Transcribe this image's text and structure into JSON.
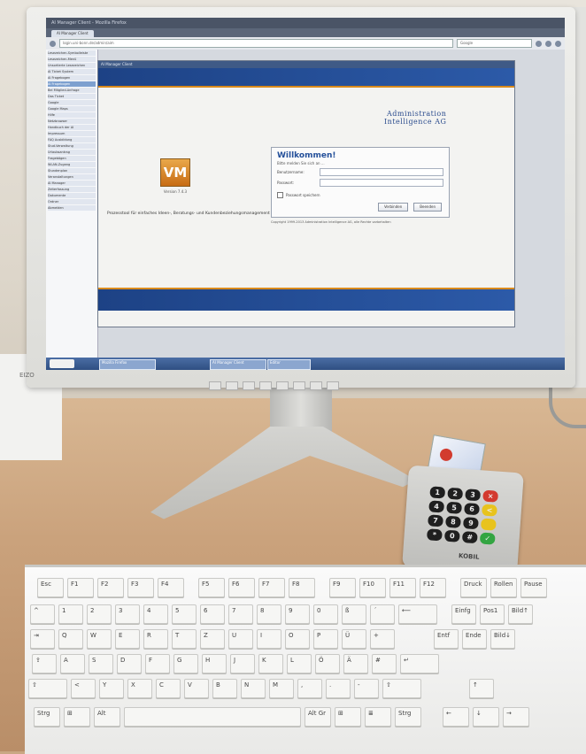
{
  "browser": {
    "window_title": "AI Manager Client - Mozilla Firefox",
    "tab_label": "AI Manager Client",
    "url": "login.uni-bonn.de/admin/aim",
    "search_placeholder": "Google"
  },
  "sidebar": {
    "items": [
      "Lesezeichen-Symbolleiste",
      "Lesezeichen-Menü",
      "Unsortierte Lesezeichen",
      "AI Ticket System",
      "AI Fragebogen",
      "AI Fragebogen",
      "Bei Mitglied-Anfrage",
      "Das Ticket",
      "Google",
      "Google Maps",
      "Hilfe",
      "Netzbrowser",
      "Handbuch der AI",
      "Impressum",
      "FAQ Ausbildung",
      "Stud-Verwaltung",
      "Urlaubsantrag",
      "Fragebögen",
      "WLAN-Zugang",
      "Stundenplan",
      "Veranstaltungen",
      "AI Manager",
      "Zeiterfassung",
      "Dokumente",
      "Ordner",
      "Abmelden"
    ],
    "selected_index": 5
  },
  "app_window": {
    "title": "AI Manager Client",
    "brand_line1": "Administration",
    "brand_line2": "Intelligence AG",
    "logo": "VM",
    "version": "Version 7.4.3",
    "tagline": "Prozesstool für einfaches Ideen-, Beratungs- und Kundenbeziehungsmanagement",
    "login": {
      "title": "Willkommen!",
      "subtitle": "Bitte melden Sie sich an ...",
      "username_label": "Benutzername:",
      "password_label": "Passwort:",
      "remember_label": "Passwort speichern",
      "connect_button": "Verbinden",
      "cancel_button": "Beenden"
    },
    "copyright": "Copyright 1999-2013 Administration Intelligence AG, alle Rechte vorbehalten"
  },
  "taskbar": {
    "tasks": [
      "Mozilla Firefox",
      "AI Manager Client",
      "Editor"
    ]
  },
  "monitor": {
    "brand": "EIZO"
  },
  "card_reader": {
    "brand": "KOBIL",
    "keys": [
      "1",
      "2",
      "3",
      "×",
      "4",
      "5",
      "6",
      "<",
      "7",
      "8",
      "9",
      "",
      "*",
      "0",
      "#",
      "✓"
    ]
  },
  "keyboard": {
    "f_row": [
      "Esc",
      "F1",
      "F2",
      "F3",
      "F4",
      "F5",
      "F6",
      "F7",
      "F8",
      "F9",
      "F10",
      "F11",
      "F12",
      "Druck",
      "Rollen",
      "Pause"
    ],
    "num_row": [
      "^",
      "1",
      "2",
      "3",
      "4",
      "5",
      "6",
      "7",
      "8",
      "9",
      "0",
      "ß",
      "´",
      "⟵",
      "Einfg",
      "Pos1",
      "Bild↑"
    ],
    "q_row": [
      "⇥",
      "Q",
      "W",
      "E",
      "R",
      "T",
      "Z",
      "U",
      "I",
      "O",
      "P",
      "Ü",
      "+",
      "Entf",
      "Ende",
      "Bild↓"
    ],
    "a_row": [
      "⇪",
      "A",
      "S",
      "D",
      "F",
      "G",
      "H",
      "J",
      "K",
      "L",
      "Ö",
      "Ä",
      "#",
      "↵"
    ],
    "y_row": [
      "⇧",
      "<",
      "Y",
      "X",
      "C",
      "V",
      "B",
      "N",
      "M",
      ",",
      ".",
      "-",
      "⇧",
      "↑"
    ],
    "bottom_row": [
      "Strg",
      "⊞",
      "Alt",
      "",
      "Alt Gr",
      "⊞",
      "≣",
      "Strg",
      "←",
      "↓",
      "→"
    ]
  }
}
